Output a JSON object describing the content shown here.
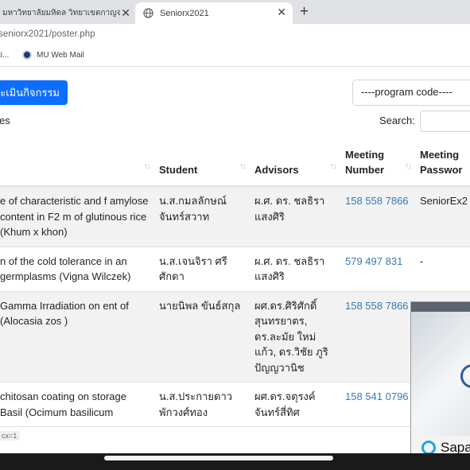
{
  "browser": {
    "tabs": [
      {
        "title": "มหาวิทยาลัยมหิดล วิทยาเขตกาญจนบุรี",
        "active": false
      },
      {
        "title": "Seniorx2021",
        "active": true
      }
    ],
    "close_glyph": "✕",
    "new_tab_glyph": "+",
    "url": "seniorx2021/poster.php",
    "bookmarks": [
      "ti...",
      "MU Web Mail"
    ]
  },
  "page": {
    "eval_button": "ระเมินกิจกรรม",
    "program_select": "----program code----",
    "entries_label": "es",
    "search_label": "Search:",
    "sort_glyph": "↑↓",
    "columns": {
      "title": "",
      "student": "Student",
      "advisors": "Advisors",
      "meeting_number_line1": "Meeting",
      "meeting_number_line2": "Number",
      "meeting_password_line1": "Meeting",
      "meeting_password_line2": "Passwor"
    },
    "rows": [
      {
        "title": "e of characteristic and f amylose content in F2 m of glutinous rice (Khum x khon)",
        "student": "น.ส.กมลลักษณ์ จันทร์สวาท",
        "advisors": "ผ.ศ. ดร. ชลธิรา แสงศิริ",
        "meeting_number": "158 558 7866",
        "meeting_password": "SeniorEx2"
      },
      {
        "title": "n of the cold tolerance in an germplasms (Vigna Wilczek)",
        "student": "น.ส.เจนจิรา ศรีศักดา",
        "advisors": "ผ.ศ. ดร. ชลธิรา แสงศิริ",
        "meeting_number": "579 497 831",
        "meeting_password": "-"
      },
      {
        "title": "Gamma Irradiation on ent of (Alocasia zos )",
        "student": "นายนิพล ขันธ์สกุล",
        "advisors": "ผศ.ดร.ศิริศักดิ์ สุนทรยาตร, ดร.ละมัย ใหม่แก้ว, ดร.วิชัย ภูริปัญญวานิช",
        "meeting_number": "158 558 7866",
        "meeting_password": ""
      },
      {
        "title": "chitosan coating on storage Basil (Ocimum basilicum",
        "student": "น.ส.ประกายดาว พักวงศ์ทอง",
        "advisors": "ผศ.ดร.จตุรงค์ จันทร์สี่ทิศ",
        "meeting_number": "158 541 0796",
        "meeting_password": ""
      }
    ],
    "tooltip": "cx=1"
  },
  "video_overlay": {
    "app_label": "Sapa"
  },
  "colors": {
    "primary_button": "#0d6efd",
    "link": "#337ab7",
    "tab_strip": "#dfe1e5",
    "striped_row": "#f2f2f2"
  },
  "icons": {
    "active_tab": "globe-icon",
    "bookmark": "mu-logo-icon",
    "sort": "sort-icon",
    "video": "sapa-logo-icon"
  }
}
